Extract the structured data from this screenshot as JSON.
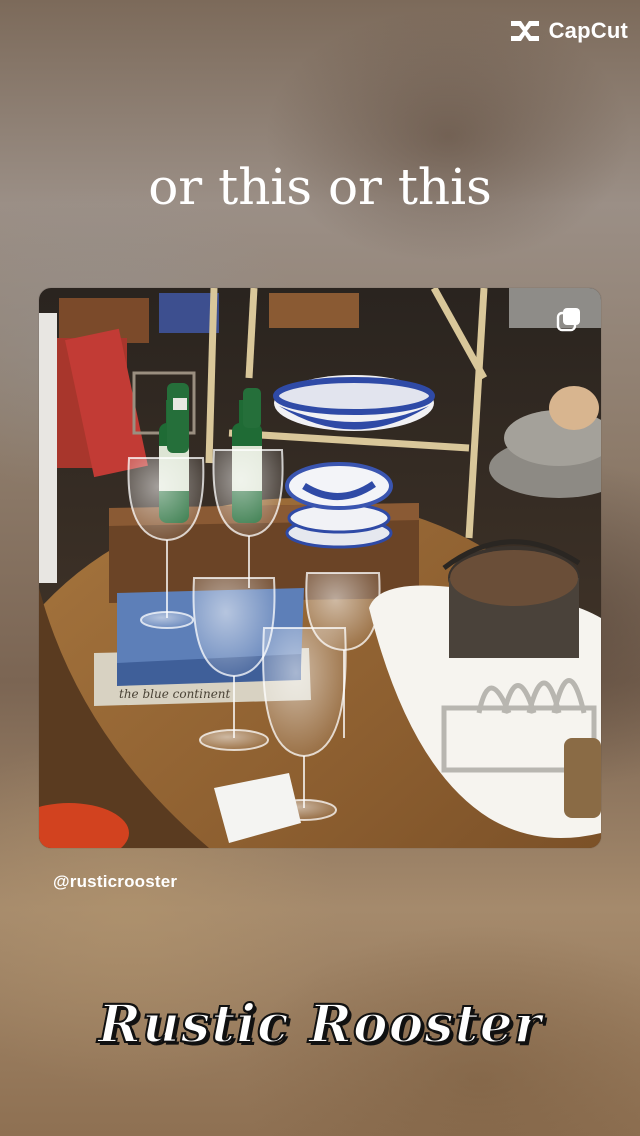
{
  "app": {
    "watermark": "CapCut",
    "watermark_icon": "capcut-logo-icon"
  },
  "overlay": {
    "headline": "or this or this",
    "handle": "@rusticrooster",
    "brand_title": "Rustic Rooster"
  },
  "photo": {
    "book_title": "the blue continent",
    "post_icon": "multiple-posts-icon"
  },
  "colors": {
    "text": "#ffffff",
    "brand_outline": "#111111",
    "table_wood": "#9a6b3d",
    "porcelain_blue": "#2f4aa6"
  }
}
